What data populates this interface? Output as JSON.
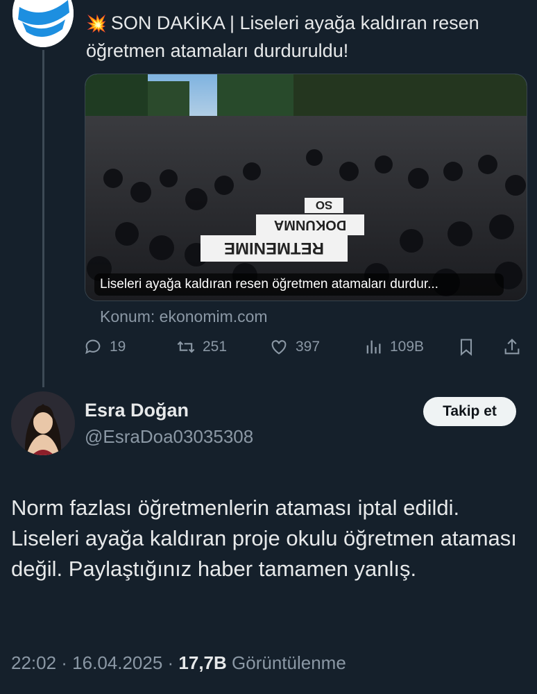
{
  "parent_tweet": {
    "emoji": "💥",
    "text": "SON DAKİKA | Liseleri ayağa kaldıran resen öğretmen atamaları durduruldu!",
    "media_caption": "Liseleri ayağa kaldıran resen öğretmen atamaları durdur...",
    "banner_texts": [
      "SO",
      "DOKUNMA",
      "RETMENIME"
    ],
    "source": "Konum: ekonomim.com",
    "replies": "19",
    "retweets": "251",
    "likes": "397",
    "views": "109B"
  },
  "reply": {
    "name": "Esra Doğan",
    "handle": "@EsraDoa03035308",
    "follow_label": "Takip et",
    "text": "Norm fazlası öğretmenlerin ataması iptal edildi. Liseleri ayağa kaldıran proje okulu öğretmen ataması değil. Paylaştığınız haber tamamen yanlış.",
    "time": "22:02 · 16.04.2025 · ",
    "views_count": "17,7B",
    "views_label": " Görüntülenme"
  },
  "icons": [
    "reply-icon",
    "retweet-icon",
    "like-icon",
    "views-icon",
    "bookmark-icon",
    "share-icon"
  ],
  "colors": {
    "background": "#15202b",
    "text": "#e7e9ea",
    "secondary": "#8b98a5",
    "button": "#eff3f4"
  }
}
